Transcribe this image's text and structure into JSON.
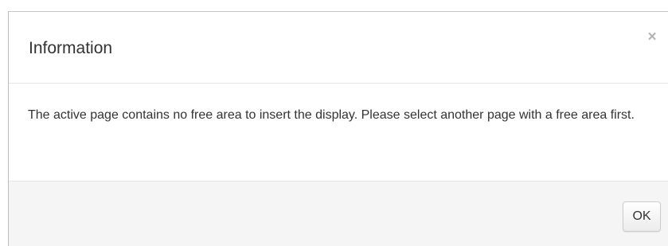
{
  "dialog": {
    "title": "Information",
    "close_label": "×",
    "message": "The active page contains no free area to insert the display. Please select another page with a free area first.",
    "ok_label": "OK"
  }
}
